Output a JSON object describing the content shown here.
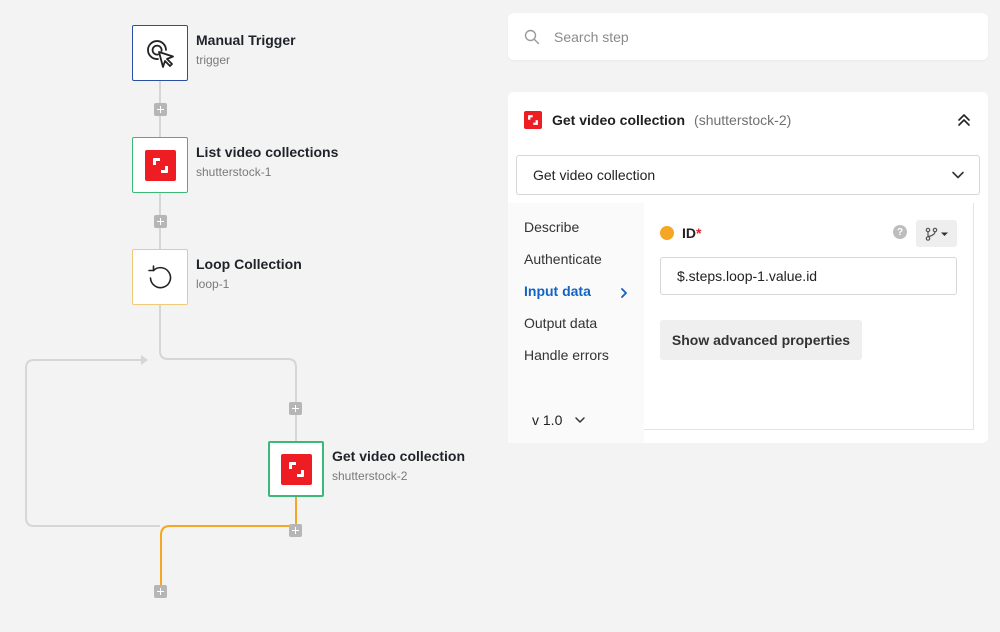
{
  "workflow": {
    "nodes": [
      {
        "title": "Manual Trigger",
        "subtitle": "trigger",
        "icon": "cursor-click-icon"
      },
      {
        "title": "List video collections",
        "subtitle": "shutterstock-1",
        "icon": "shutterstock-logo-icon"
      },
      {
        "title": "Loop Collection",
        "subtitle": "loop-1",
        "icon": "loop-icon"
      },
      {
        "title": "Get video collection",
        "subtitle": "shutterstock-2",
        "icon": "shutterstock-logo-icon"
      }
    ],
    "colors": {
      "connector": "#d6d6d6",
      "active_connector": "#f5a623",
      "plus": "#b6b6b6",
      "shutterstock_red": "#ee1d23"
    }
  },
  "search": {
    "placeholder": "Search step"
  },
  "step_panel": {
    "title": "Get video collection",
    "key": "(shutterstock-2)",
    "action_selected": "Get video collection",
    "tabs": [
      "Describe",
      "Authenticate",
      "Input data",
      "Output data",
      "Handle errors"
    ],
    "active_tab": "Input data",
    "version": "v 1.0",
    "field": {
      "label": "ID",
      "required_mark": "*",
      "help": "?",
      "value": "$.steps.loop-1.value.id"
    },
    "advanced_button": "Show advanced properties",
    "colors": {
      "active_tab": "#1363c7",
      "required": "#e0242a",
      "status_dot": "#f5a623"
    }
  }
}
